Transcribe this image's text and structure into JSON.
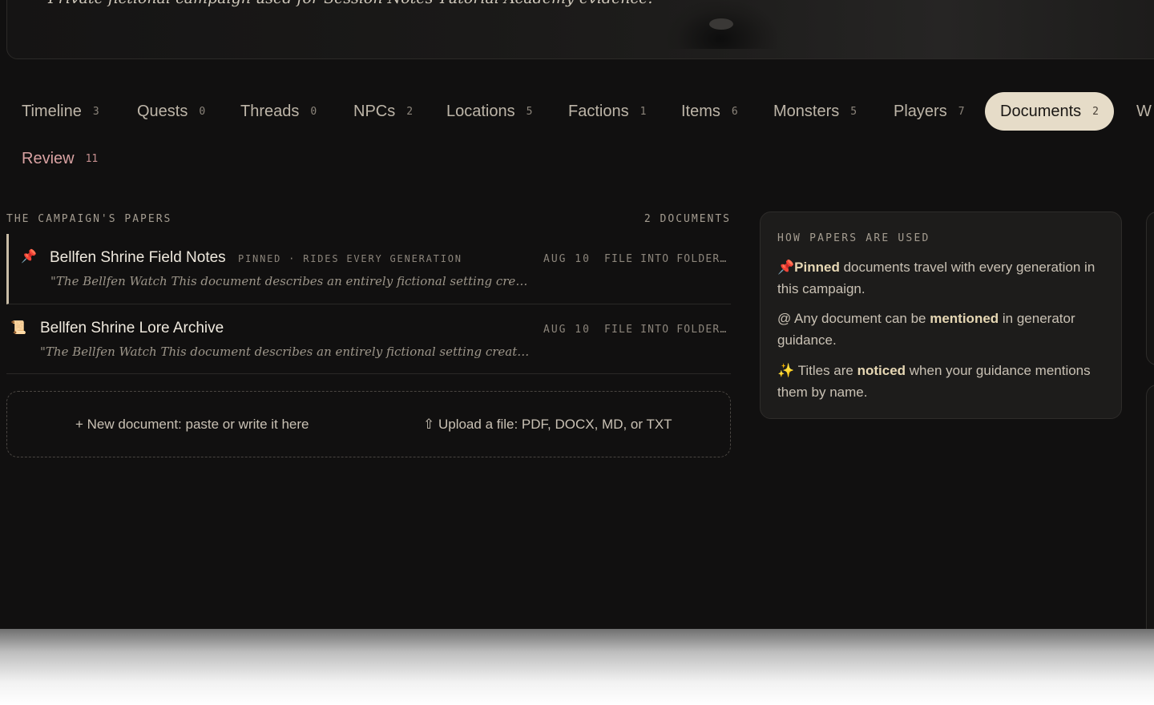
{
  "hero": {
    "subtitle": "Private fictional campaign used for Session Notes Tutorial Academy evidence."
  },
  "tabs": [
    {
      "label": "Timeline",
      "count": "3"
    },
    {
      "label": "Quests",
      "count": "0"
    },
    {
      "label": "Threads",
      "count": "0"
    },
    {
      "label": "NPCs",
      "count": "2"
    },
    {
      "label": "Locations",
      "count": "5"
    },
    {
      "label": "Factions",
      "count": "1"
    },
    {
      "label": "Items",
      "count": "6"
    },
    {
      "label": "Monsters",
      "count": "5"
    },
    {
      "label": "Players",
      "count": "7"
    },
    {
      "label": "Documents",
      "count": "2",
      "active": true
    },
    {
      "label": "W",
      "count": ""
    },
    {
      "label": "Review",
      "count": "11"
    }
  ],
  "documents_section": {
    "heading": "THE CAMPAIGN'S PAPERS",
    "count_label": "2 DOCUMENTS",
    "documents": [
      {
        "icon": "pin-icon",
        "icon_glyph": "📌",
        "title": "Bellfen Shrine Field Notes",
        "badge": "PINNED · RIDES EVERY GENERATION",
        "date": "AUG 10",
        "action": "FILE INTO FOLDER…",
        "excerpt": "\"The Bellfen Watch This document describes an entirely fictional setting created f…"
      },
      {
        "icon": "scroll-icon",
        "icon_glyph": "📜",
        "title": "Bellfen Shrine Lore Archive",
        "badge": "",
        "date": "AUG 10",
        "action": "FILE INTO FOLDER…",
        "excerpt": "\"The Bellfen Watch This document describes an entirely fictional setting created for…"
      }
    ],
    "new_document": "+ New document: paste or write it here",
    "upload": "⇧ Upload a file: PDF, DOCX, MD, or TXT"
  },
  "help_panel": {
    "title": "HOW PAPERS ARE USED",
    "pinned": {
      "icon": "📌",
      "strong": "Pinned",
      "text": " documents travel with every generation in this campaign."
    },
    "mentioned": {
      "prefix": "@ Any document can be ",
      "strong": "mentioned",
      "text": " in generator guidance."
    },
    "noticed": {
      "icon": "✨",
      "prefix": " Titles are ",
      "strong": "noticed",
      "text": " when your guidance mentions them by name."
    }
  }
}
